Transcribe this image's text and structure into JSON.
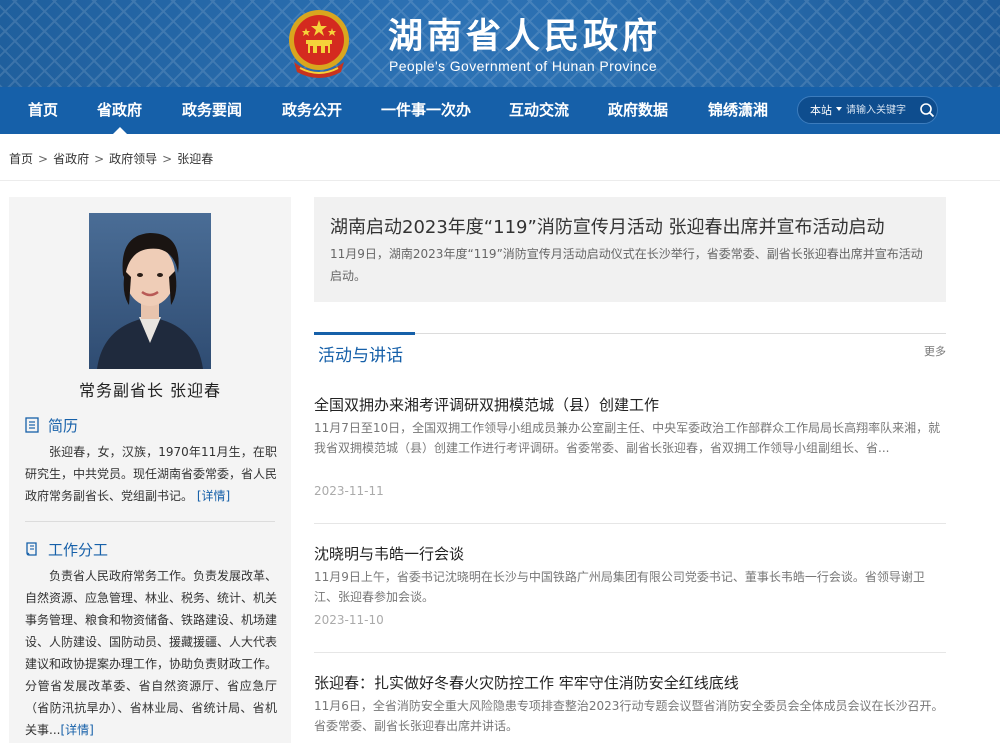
{
  "header": {
    "title": "湖南省人民政府",
    "subtitle": "People's Government of Hunan Province"
  },
  "nav": {
    "items": [
      {
        "label": "首页"
      },
      {
        "label": "省政府"
      },
      {
        "label": "政务要闻"
      },
      {
        "label": "政务公开"
      },
      {
        "label": "一件事一次办"
      },
      {
        "label": "互动交流"
      },
      {
        "label": "政府数据"
      },
      {
        "label": "锦绣潇湘"
      }
    ],
    "active_index": 1
  },
  "search": {
    "scope": "本站",
    "placeholder": "请输入关键字"
  },
  "breadcrumb": {
    "items": [
      "首页",
      "省政府",
      "政府领导",
      "张迎春"
    ],
    "separator": ">"
  },
  "profile": {
    "name": "常务副省长  张迎春",
    "bio_heading": "简历",
    "bio": "张迎春，女，汉族，1970年11月生，在职研究生，中共党员。现任湖南省委常委，省人民政府常务副省长、党组副书记。",
    "bio_link": "[详情]",
    "duty_heading": "工作分工",
    "duties": "负责省人民政府常务工作。负责发展改革、自然资源、应急管理、林业、税务、统计、机关事务管理、粮食和物资储备、铁路建设、机场建设、人防建设、国防动员、援藏援疆、人大代表建议和政协提案办理工作，协助负责财政工作。分管省发展改革委、省自然资源厅、省应急厅（省防汛抗旱办）、省林业局、省统计局、省机关事...",
    "duties_link": "[详情]"
  },
  "featured": {
    "title": "湖南启动2023年度“119”消防宣传月活动 张迎春出席并宣布活动启动",
    "summary": "11月9日，湖南2023年度“119”消防宣传月活动启动仪式在长沙举行，省委常委、副省长张迎春出席并宣布活动启动。"
  },
  "section": {
    "title": "活动与讲话",
    "more": "更多"
  },
  "news": [
    {
      "title": "全国双拥办来湘考评调研双拥模范城（县）创建工作",
      "summary": "11月7日至10日，全国双拥工作领导小组成员兼办公室副主任、中央军委政治工作部群众工作局局长高翔率队来湘，就我省双拥模范城（县）创建工作进行考评调研。省委常委、副省长张迎春，省双拥工作领导小组副组长、省...",
      "date": "2023-11-11"
    },
    {
      "title": "沈晓明与韦皓一行会谈",
      "summary": "11月9日上午，省委书记沈晓明在长沙与中国铁路广州局集团有限公司党委书记、董事长韦皓一行会谈。省领导谢卫江、张迎春参加会谈。",
      "date": "2023-11-10"
    },
    {
      "title": "张迎春：扎实做好冬春火灾防控工作 牢牢守住消防安全红线底线",
      "summary": "11月6日，全省消防安全重大风险隐患专项排查整治2023行动专题会议暨省消防安全委员会全体成员会议在长沙召开。省委常委、副省长张迎春出席并讲话。",
      "date": ""
    }
  ],
  "colors": {
    "primary": "#1660a9",
    "header_bg": "#2a6fb0",
    "sidebar_bg": "#f4f4f4",
    "featured_bg": "#f1f1f1"
  }
}
